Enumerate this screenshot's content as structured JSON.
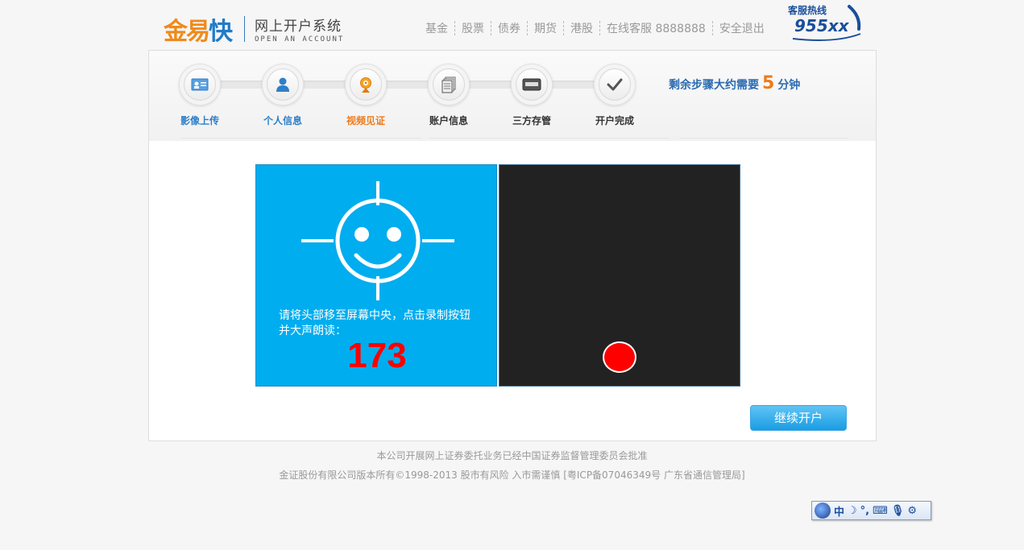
{
  "brand": {
    "logo_part1": "金易",
    "logo_part2": "快",
    "system_cn": "网上开户系统",
    "system_en": "OPEN AN ACCOUNT"
  },
  "topnav": [
    "基金",
    "股票",
    "债券",
    "期货",
    "港股",
    "在线客服 8888888",
    "安全退出"
  ],
  "hotline": {
    "label": "客服热线",
    "number": "955xx"
  },
  "steps": [
    {
      "label": "影像上传",
      "state": "done",
      "icon": "id-card-icon"
    },
    {
      "label": "个人信息",
      "state": "done",
      "icon": "person-icon"
    },
    {
      "label": "视频见证",
      "state": "current",
      "icon": "webcam-icon"
    },
    {
      "label": "账户信息",
      "state": "todo",
      "icon": "documents-icon"
    },
    {
      "label": "三方存管",
      "state": "todo",
      "icon": "card-icon"
    },
    {
      "label": "开户完成",
      "state": "todo",
      "icon": "checkmark-icon"
    }
  ],
  "remaining": {
    "prefix": "剩余步骤大约需要",
    "minutes": "5",
    "suffix": "分钟"
  },
  "video": {
    "instruction": "请将头部移至屏幕中央，点击录制按钮并大声朗读：",
    "code": "173"
  },
  "continue_label": "继续开户",
  "footer": {
    "line1": "本公司开展网上证券委托业务已经中国证券监督管理委员会批准",
    "line2": "金证股份有限公司版本所有©1998-2013  股市有风险 入市需谨慎  [粤ICP备07046349号 广东省通信管理局]"
  },
  "ime": {
    "mode": "中"
  },
  "colors": {
    "accent_blue": "#2f7fc8",
    "accent_orange": "#ee7a1a",
    "guide_bg": "#00adef",
    "record_red": "#ff0000"
  }
}
